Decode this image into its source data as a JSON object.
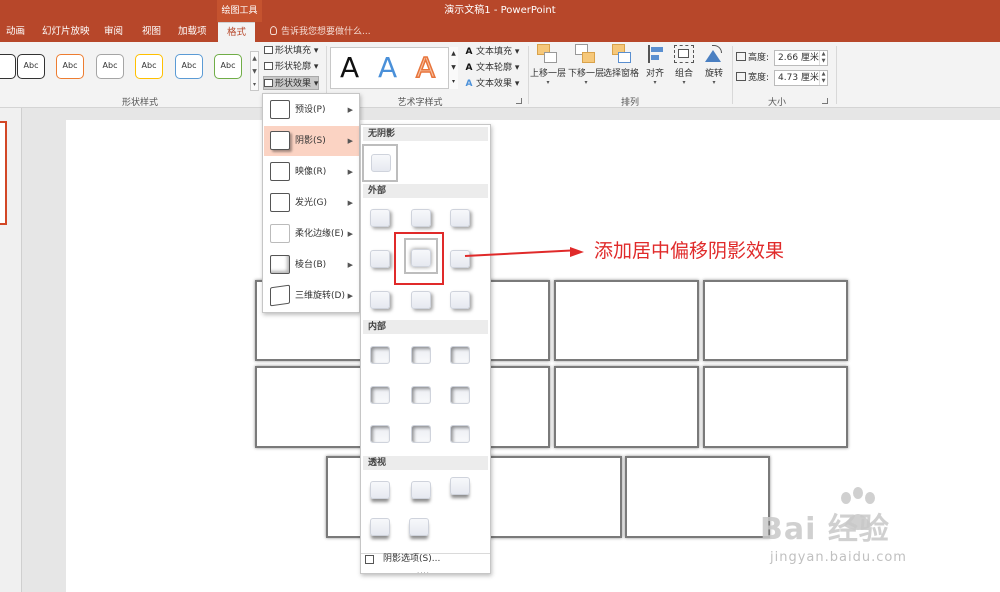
{
  "window": {
    "contextual_group": "绘图工具",
    "title": "演示文稿1 - PowerPoint"
  },
  "tabs": [
    {
      "label": "动画"
    },
    {
      "label": "幻灯片放映"
    },
    {
      "label": "审阅"
    },
    {
      "label": "视图"
    },
    {
      "label": "加载项"
    },
    {
      "label": "格式",
      "active": true
    }
  ],
  "tell_me": "告诉我您想要做什么...",
  "ribbon": {
    "shape_styles": {
      "label": "形状样式",
      "swatches": [
        {
          "text": "",
          "color": "#333333"
        },
        {
          "text": "Abc",
          "color": "#333333"
        },
        {
          "text": "Abc",
          "color": "#4472c4"
        },
        {
          "text": "Abc",
          "color": "#ed7d31"
        },
        {
          "text": "Abc",
          "color": "#a5a5a5"
        },
        {
          "text": "Abc",
          "color": "#ffc000"
        },
        {
          "text": "Abc",
          "color": "#5b9bd5"
        },
        {
          "text": "Abc",
          "color": "#70ad47"
        }
      ],
      "fill": "形状填充",
      "outline": "形状轮廓",
      "effects": "形状效果"
    },
    "wordart": {
      "label": "艺术字样式",
      "letters": [
        {
          "char": "A",
          "color": "#111111"
        },
        {
          "char": "A",
          "color": "#4a90d9"
        },
        {
          "char": "A",
          "color": "#f0a070"
        }
      ],
      "text_fill": "文本填充",
      "text_outline": "文本轮廓",
      "text_effects": "文本效果"
    },
    "arrange": {
      "label": "排列",
      "buttons": [
        "上移一层",
        "下移一层",
        "选择窗格",
        "对齐",
        "组合",
        "旋转"
      ]
    },
    "size": {
      "label": "大小",
      "height_label": "高度:",
      "height_value": "2.66 厘米",
      "width_label": "宽度:",
      "width_value": "4.73 厘米"
    }
  },
  "effects_menu": {
    "items": [
      {
        "label": "预设(P)"
      },
      {
        "label": "阴影(S)",
        "highlighted": true
      },
      {
        "label": "映像(R)"
      },
      {
        "label": "发光(G)"
      },
      {
        "label": "柔化边缘(E)"
      },
      {
        "label": "棱台(B)"
      },
      {
        "label": "三维旋转(D)"
      }
    ]
  },
  "shadow_menu": {
    "sections": {
      "none": "无阴影",
      "outer": "外部",
      "inner": "内部",
      "perspective": "透视"
    },
    "options": "阴影选项(S)..."
  },
  "annotation": {
    "text": "添加居中偏移阴影效果",
    "color": "#e02a2a"
  },
  "watermark": {
    "brand": "Bai 经验",
    "url": "jingyan.baidu.com"
  }
}
